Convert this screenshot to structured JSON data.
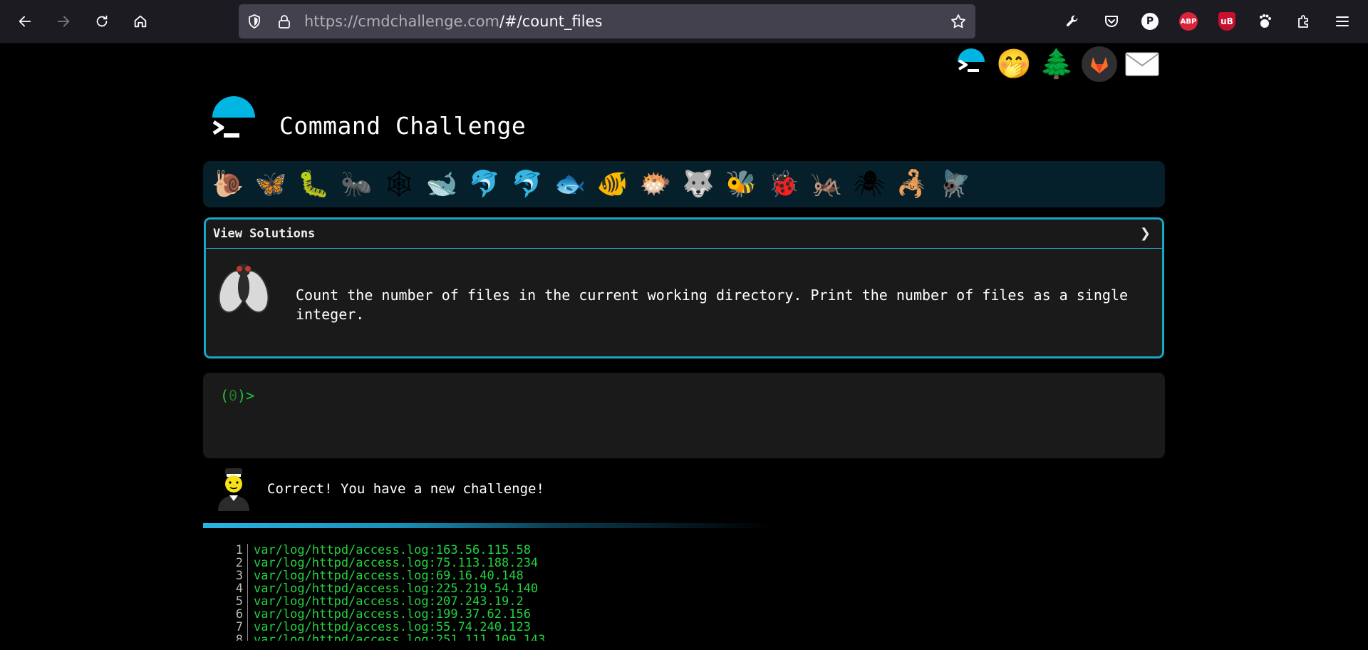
{
  "browser": {
    "url_host": "https://cmdchallenge.com",
    "url_path": "/#/count_files",
    "extensions": [
      "wrench-icon",
      "pocket-icon",
      "p-extension-icon",
      "abp-icon",
      "ublock-icon",
      "gnome-icon",
      "puzzle-icon",
      "menu-icon"
    ],
    "p_badge": "P",
    "abp_badge": "ABP",
    "ublock_badge": "uB"
  },
  "header_icons": [
    "cmdchallenge-icon",
    "shushing-face-icon",
    "tree-icon",
    "gitlab-icon",
    "mail-icon"
  ],
  "site": {
    "title": "Command Challenge"
  },
  "critters": [
    "🐌",
    "🦋",
    "🐛",
    "🐜",
    "🕸",
    "🐋",
    "🐬",
    "🐬",
    "🐟",
    "🐠",
    "🐡",
    "🐺",
    "🐝",
    "🐞",
    "🦗",
    "🕷",
    "🦂",
    "🪰"
  ],
  "challenge": {
    "view_solutions_label": "View Solutions",
    "chevron": "❯",
    "description": "Count the number of files in the current working directory. Print the number of files as a single integer."
  },
  "terminal": {
    "prompt_open": "(",
    "prompt_num": "0",
    "prompt_close": ")>"
  },
  "result": {
    "message": "Correct! You have a new challenge!",
    "progress_fraction": 0.59
  },
  "output_lines": [
    {
      "n": "1",
      "text": "var/log/httpd/access.log:163.56.115.58"
    },
    {
      "n": "2",
      "text": "var/log/httpd/access.log:75.113.188.234"
    },
    {
      "n": "3",
      "text": "var/log/httpd/access.log:69.16.40.148"
    },
    {
      "n": "4",
      "text": "var/log/httpd/access.log:225.219.54.140"
    },
    {
      "n": "5",
      "text": "var/log/httpd/access.log:207.243.19.2"
    },
    {
      "n": "6",
      "text": "var/log/httpd/access.log:199.37.62.156"
    },
    {
      "n": "7",
      "text": "var/log/httpd/access.log:55.74.240.123"
    },
    {
      "n": "8",
      "text": "var/log/httpd/access.log:251.111.109.143"
    }
  ]
}
